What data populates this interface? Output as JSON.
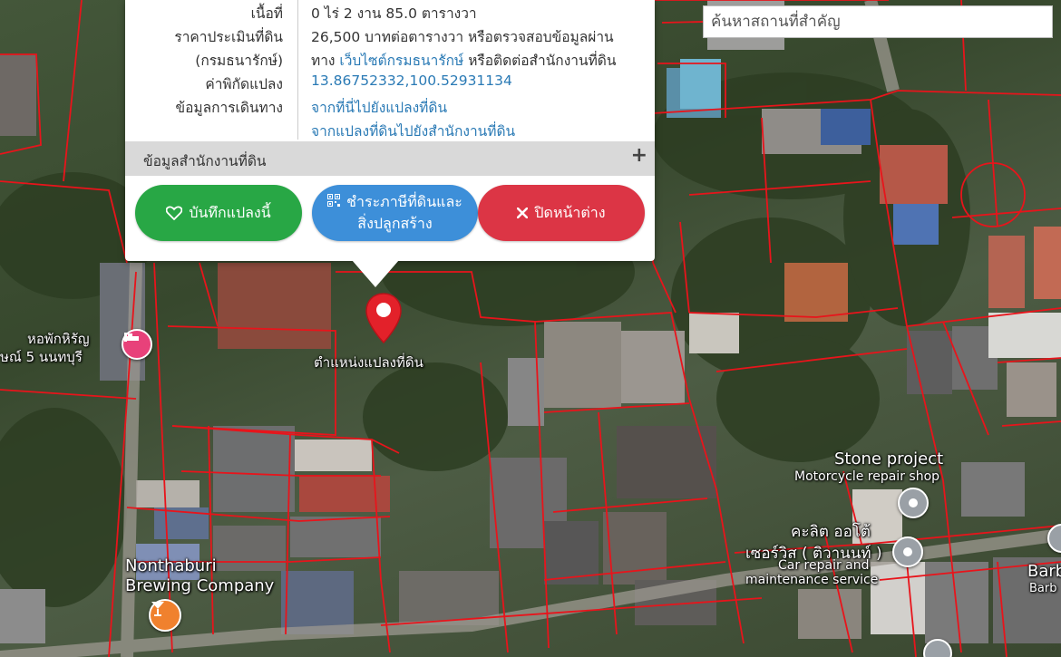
{
  "search": {
    "placeholder": "ค้นหาสถานที่สำคัญ"
  },
  "popup": {
    "rows": [
      {
        "label": "เนื้อที่",
        "value": "0 ไร่ 2 งาน 85.0 ตารางวา"
      },
      {
        "label": "ราคาประเมินที่ดิน",
        "value": "26,500 บาทต่อตารางวา หรือตรวจสอบข้อมูลผ่าน"
      },
      {
        "label": "(กรมธนารักษ์)",
        "value_prefix": "ทาง ",
        "value_link": "เว็บไซต์กรมธนารักษ์",
        "value_suffix": " หรือติดต่อสำนักงานที่ดิน"
      },
      {
        "label": "ค่าพิกัดแปลง",
        "value_link": "13.86752332,100.52931134"
      },
      {
        "label": "ข้อมูลการเดินทาง",
        "value_link": "จากที่นี่ไปยังแปลงที่ดิน"
      },
      {
        "label": "",
        "value_link": "จากแปลงที่ดินไปยังสำนักงานที่ดิน"
      }
    ],
    "office_section": "ข้อมูลสำนักงานที่ดิน",
    "expand_symbol": "+",
    "buttons": {
      "save": "บันทึกแปลงนี้",
      "pay_line1": "ชำระภาษีที่ดินและ",
      "pay_line2": "สิ่งปลูกสร้าง",
      "close": "ปิดหน้าต่าง"
    }
  },
  "map": {
    "marker_label": "ตำแหน่งแปลงที่ดิน",
    "places": [
      {
        "name_line1": "หอพักหิรัญ",
        "name_line2": "ษณ์ 5 นนทบุรี",
        "icon": "hotel-icon",
        "color": "#e8417a"
      },
      {
        "name": "Stone project",
        "subtitle": "Motorcycle repair shop",
        "icon": "repair-icon",
        "color": "#9aa0a6"
      },
      {
        "name_line1": "คะลิต ออโต้",
        "name_line2": "เซอร์วิส ( ติวานนท์ )",
        "subtitle_line1": "Car repair and",
        "subtitle_line2": "maintenance service",
        "icon": "repair-icon",
        "color": "#9aa0a6"
      },
      {
        "name_line1": "Nonthaburi",
        "name_line2": "Brewing Company",
        "icon": "bar-icon",
        "color": "#f0812e"
      },
      {
        "name_line1": "Barb",
        "name_line2": "Barb"
      }
    ],
    "parcel_line_color": "#e8141b",
    "marker_color": "#e3212a"
  }
}
